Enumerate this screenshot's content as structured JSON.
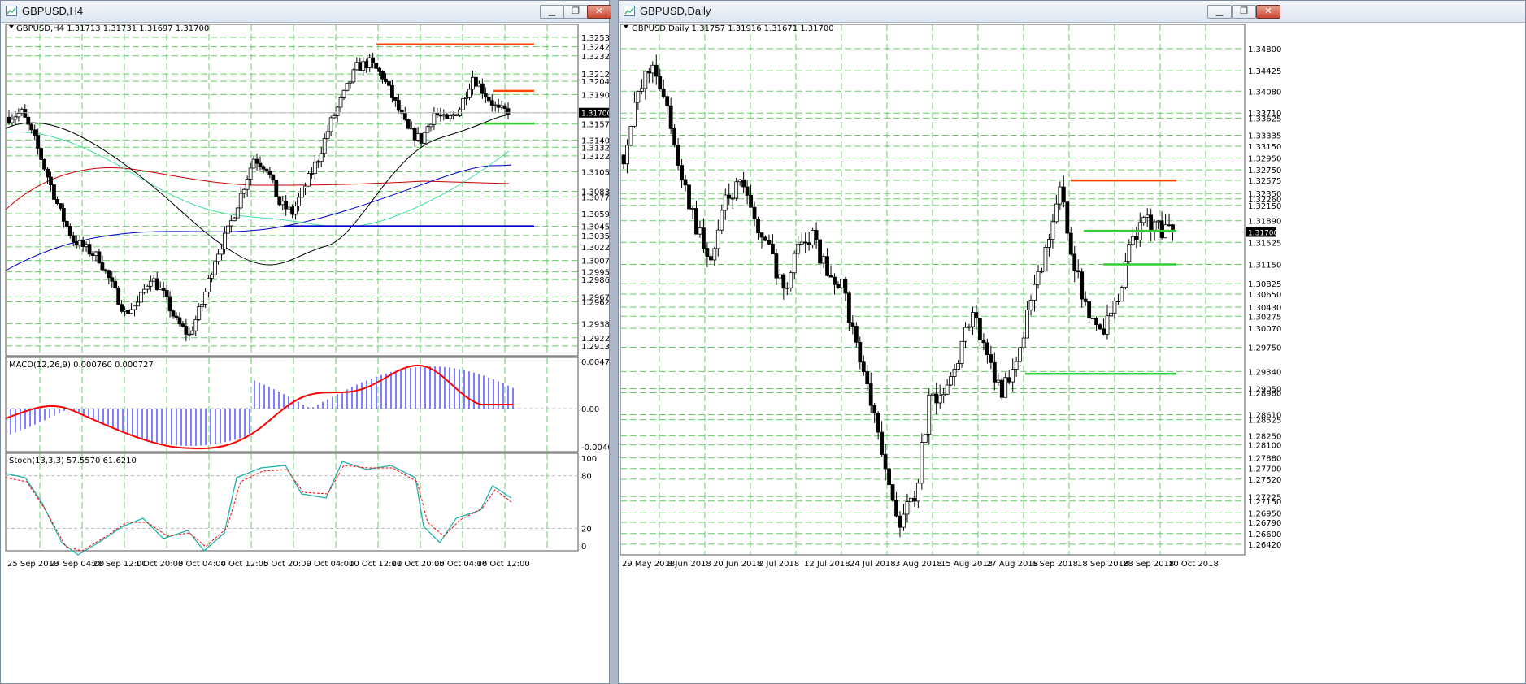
{
  "colors": {
    "grid": "#66cc66",
    "resistance": "#ff4500",
    "support": "#32cd32",
    "blue_line": "#0000cd",
    "macd_hist": "#0000ff",
    "macd_signal": "#ff0000",
    "stoch_main": "#20b2aa",
    "stoch_signal": "#ff0000",
    "price_tag": "#000000"
  },
  "windows": {
    "left": {
      "title": "GBPUSD,H4",
      "header": "GBPUSD,H4  1.31713 1.31731 1.31697 1.31700",
      "min_btn": "▁",
      "max_btn": "❐",
      "close_btn": "✕",
      "price_levels": [
        "1.32530",
        "1.32425",
        "1.32325",
        "1.32125",
        "1.32045",
        "1.31900",
        "1.31700",
        "1.31575",
        "1.31400",
        "1.31320",
        "1.31225",
        "1.31050",
        "1.30835",
        "1.30775",
        "1.30590",
        "1.30450",
        "1.30350",
        "1.30225",
        "1.30075",
        "1.29950",
        "1.29865",
        "1.29675",
        "1.29620",
        "1.29380",
        "1.29225",
        "1.29135"
      ],
      "price_tag": "1.31700",
      "time_labels": [
        "25 Sep 2018",
        "27 Sep 04:00",
        "28 Sep 12:00",
        "1 Oct 20:00",
        "3 Oct 04:00",
        "4 Oct 12:00",
        "5 Oct 20:00",
        "9 Oct 04:00",
        "10 Oct 12:00",
        "11 Oct 20:00",
        "15 Oct 04:00",
        "16 Oct 12:00"
      ],
      "macd": {
        "label": "MACD(12,26,9) 0.000760 0.000727",
        "levels": [
          "0.004718",
          "0.00",
          "-0.004088"
        ]
      },
      "stoch": {
        "label": "Stoch(13,3,3) 57.5570 61.6210",
        "levels": [
          "100",
          "80",
          "20",
          "0"
        ]
      }
    },
    "right": {
      "title": "GBPUSD,Daily",
      "header": "GBPUSD,Daily  1.31757 1.31916 1.31671 1.31700",
      "min_btn": "▁",
      "max_btn": "❐",
      "close_btn": "✕",
      "price_levels": [
        "1.34800",
        "1.34425",
        "1.34080",
        "1.33710",
        "1.33625",
        "1.33335",
        "1.33150",
        "1.32950",
        "1.32750",
        "1.32575",
        "1.32350",
        "1.32260",
        "1.32150",
        "1.31890",
        "1.31700",
        "1.31525",
        "1.31150",
        "1.30825",
        "1.30650",
        "1.30430",
        "1.30275",
        "1.30070",
        "1.29750",
        "1.29340",
        "1.29050",
        "1.28980",
        "1.28610",
        "1.28525",
        "1.28250",
        "1.28100",
        "1.27880",
        "1.27700",
        "1.27520",
        "1.27225",
        "1.27150",
        "1.26950",
        "1.26790",
        "1.26600",
        "1.26420"
      ],
      "price_tag": "1.31700",
      "time_labels": [
        "29 May 2018",
        "8 Jun 2018",
        "20 Jun 2018",
        "2 Jul 2018",
        "12 Jul 2018",
        "24 Jul 2018",
        "3 Aug 2018",
        "15 Aug 2018",
        "27 Aug 2018",
        "6 Sep 2018",
        "18 Sep 2018",
        "28 Sep 2018",
        "10 Oct 2018"
      ]
    }
  }
}
